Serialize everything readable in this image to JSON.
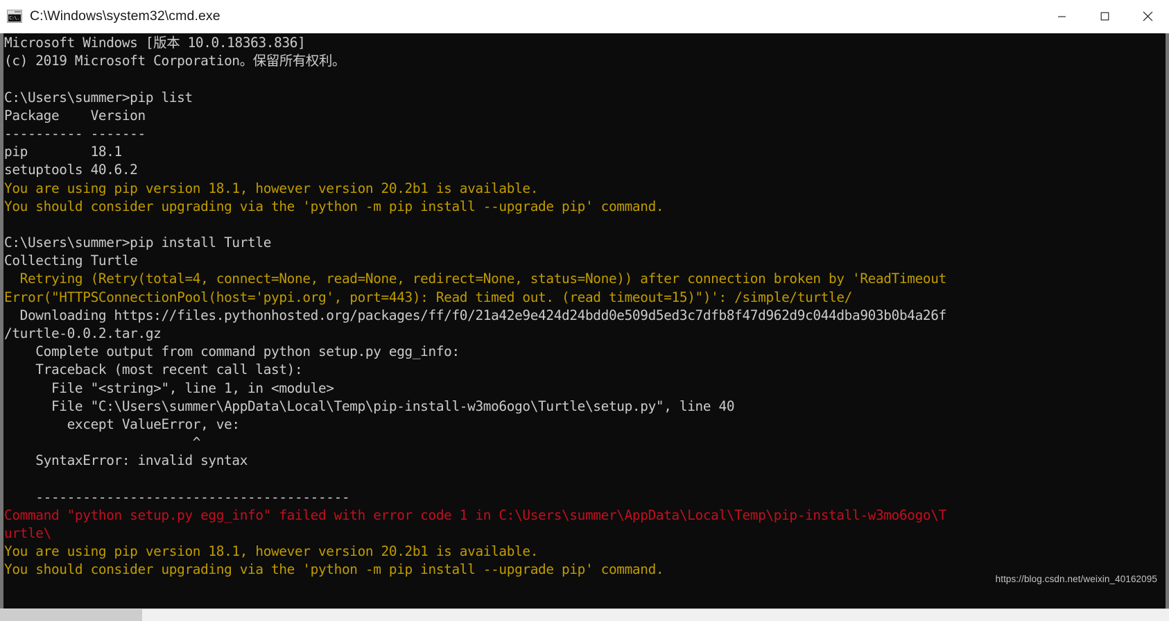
{
  "window": {
    "title": "C:\\Windows\\system32\\cmd.exe",
    "icon": "cmd-icon",
    "icon_text": "C:\\.",
    "buttons": {
      "minimize": "minimize-button",
      "maximize": "maximize-button",
      "close": "close-button"
    }
  },
  "colors": {
    "background": "#0c0c0c",
    "text": "#cccccc",
    "warning": "#c19c00",
    "error": "#c50f1f",
    "titlebar": "#ffffff"
  },
  "watermark": "https://blog.csdn.net/weixin_40162095",
  "console": {
    "lines": [
      {
        "text": "Microsoft Windows [版本 10.0.18363.836]",
        "color": "white"
      },
      {
        "text": "(c) 2019 Microsoft Corporation。保留所有权利。",
        "color": "white"
      },
      {
        "text": "",
        "color": "white"
      },
      {
        "text": "C:\\Users\\summer>pip list",
        "color": "white"
      },
      {
        "text": "Package    Version",
        "color": "white"
      },
      {
        "text": "---------- -------",
        "color": "white"
      },
      {
        "text": "pip        18.1",
        "color": "white"
      },
      {
        "text": "setuptools 40.6.2",
        "color": "white"
      },
      {
        "text": "You are using pip version 18.1, however version 20.2b1 is available.",
        "color": "yellow"
      },
      {
        "text": "You should consider upgrading via the 'python -m pip install --upgrade pip' command.",
        "color": "yellow"
      },
      {
        "text": "",
        "color": "white"
      },
      {
        "text": "C:\\Users\\summer>pip install Turtle",
        "color": "white"
      },
      {
        "text": "Collecting Turtle",
        "color": "white"
      },
      {
        "text": "  Retrying (Retry(total=4, connect=None, read=None, redirect=None, status=None)) after connection broken by 'ReadTimeout",
        "color": "yellow"
      },
      {
        "text": "Error(\"HTTPSConnectionPool(host='pypi.org', port=443): Read timed out. (read timeout=15)\")': /simple/turtle/",
        "color": "yellow"
      },
      {
        "text": "  Downloading https://files.pythonhosted.org/packages/ff/f0/21a42e9e424d24bdd0e509d5ed3c7dfb8f47d962d9c044dba903b0b4a26f",
        "color": "white"
      },
      {
        "text": "/turtle-0.0.2.tar.gz",
        "color": "white"
      },
      {
        "text": "    Complete output from command python setup.py egg_info:",
        "color": "white"
      },
      {
        "text": "    Traceback (most recent call last):",
        "color": "white"
      },
      {
        "text": "      File \"<string>\", line 1, in <module>",
        "color": "white"
      },
      {
        "text": "      File \"C:\\Users\\summer\\AppData\\Local\\Temp\\pip-install-w3mo6ogo\\Turtle\\setup.py\", line 40",
        "color": "white"
      },
      {
        "text": "        except ValueError, ve:",
        "color": "white"
      },
      {
        "text": "                        ^",
        "color": "white"
      },
      {
        "text": "    SyntaxError: invalid syntax",
        "color": "white"
      },
      {
        "text": "",
        "color": "white"
      },
      {
        "text": "    ----------------------------------------",
        "color": "white"
      },
      {
        "text": "Command \"python setup.py egg_info\" failed with error code 1 in C:\\Users\\summer\\AppData\\Local\\Temp\\pip-install-w3mo6ogo\\T",
        "color": "red"
      },
      {
        "text": "urtle\\",
        "color": "red"
      },
      {
        "text": "You are using pip version 18.1, however version 20.2b1 is available.",
        "color": "yellow"
      },
      {
        "text": "You should consider upgrading via the 'python -m pip install --upgrade pip' command.",
        "color": "yellow"
      }
    ]
  },
  "scrollbar": {
    "orientation": "horizontal",
    "thumb_label": "horizontal-scroll-thumb"
  }
}
